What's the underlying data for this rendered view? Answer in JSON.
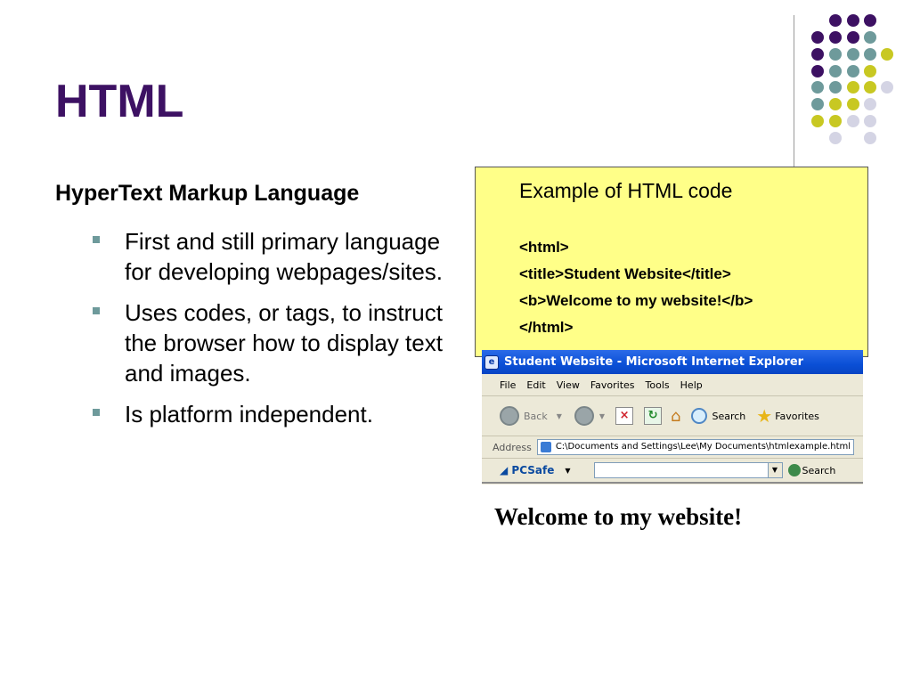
{
  "slide": {
    "title": "HTML",
    "subtitle": "HyperText Markup Language",
    "bullets": [
      "First and still primary language for developing webpages/sites.",
      "Uses codes, or tags, to instruct the browser how to display text and images.",
      "Is platform independent."
    ]
  },
  "code_box": {
    "caption": "Example of HTML code",
    "lines": [
      "<html>",
      "<title>Student Website</title>",
      "<b>Welcome to my website!</b>",
      "</html>"
    ],
    "background": "#ffff88"
  },
  "browser": {
    "window_title": "Student Website - Microsoft Internet Explorer",
    "menu": [
      "File",
      "Edit",
      "View",
      "Favorites",
      "Tools",
      "Help"
    ],
    "toolbar": {
      "back_label": "Back",
      "search_label": "Search",
      "favorites_label": "Favorites"
    },
    "address_label": "Address",
    "address_value": "C:\\Documents and Settings\\Lee\\My Documents\\htmlexample.html",
    "links_bar": {
      "brand": "PCSafe",
      "search_label": "Search"
    },
    "page_heading": "Welcome to my website!"
  },
  "colors": {
    "title": "#3d1163",
    "bullet": "#6e9a9b",
    "dot_purple": "#3d1163",
    "dot_teal": "#6e9a9b",
    "dot_yellow": "#c8c822",
    "dot_lavender": "#d4d4e4"
  },
  "icons": {
    "back": "back-arrow-icon",
    "forward": "forward-arrow-icon",
    "stop": "stop-icon",
    "refresh": "refresh-icon",
    "home": "home-icon",
    "search": "magnifier-icon",
    "favorites": "star-icon"
  }
}
